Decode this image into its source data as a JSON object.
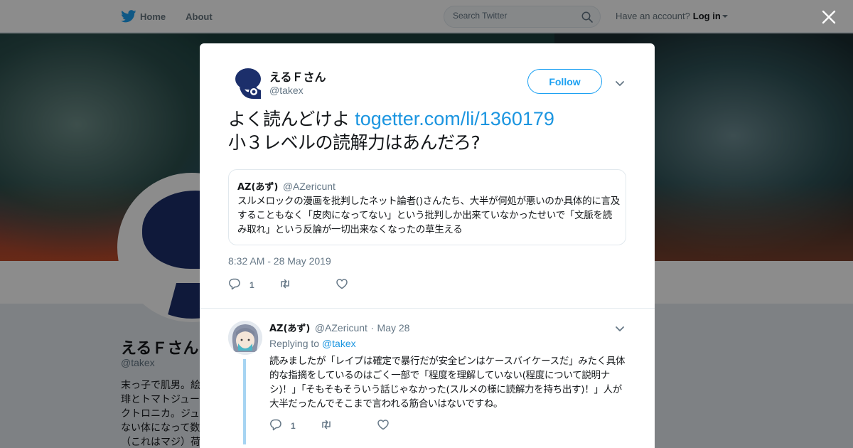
{
  "nav": {
    "home_label": "Home",
    "about_label": "About",
    "search_placeholder": "Search Twitter",
    "account_prompt": "Have an account?",
    "login_label": "Log in",
    "brand_color": "#1da1f2"
  },
  "profile": {
    "name": "えるＦさん",
    "handle": "@takex",
    "bio_lines": [
      "末っ子で肌男。絵",
      "琲とトマトジュー",
      "クトロニカ。ジュ",
      "ない体になって数",
      "（これはマジ）荷"
    ]
  },
  "tweet": {
    "author_name": "えるＦさん",
    "author_handle": "@takex",
    "follow_label": "Follow",
    "text_before_link": "よく読んどけよ ",
    "link_text": "togetter.com/li/1360179",
    "text_after_link": "小３レベルの読解力はあんだろ?",
    "quote": {
      "name": "AZ(あず)",
      "handle": "@AZericunt",
      "text": "スルメロックの漫画を批判したネット論者()さんたち、大半が何処が悪いのか具体的に言及することもなく「皮肉になってない」という批判しか出来ていなかったせいで「文脈を読み取れ」という反論が一切出来なくなったの草生える"
    },
    "timestamp": "8:32 AM - 28 May 2019",
    "reply_count": "1",
    "link_color": "#1b95e0"
  },
  "reply": {
    "name": "AZ(あず)",
    "handle": "@AZericunt",
    "separator": "·",
    "date": "May 28",
    "replying_prefix": "Replying to",
    "replying_to": "@takex",
    "text": "読みましたが「レイプは確定で暴行だが安全ピンはケースバイケースだ」みたく具体的な指摘をしているのはごく一部で「程度を理解していない(程度について説明ナシ)！」「そもそもそういう話じゃなかった(スルメの様に読解力を持ち出す)！」人が大半だったんでそこまで言われる筋合いはないですね。",
    "reply_count": "1"
  },
  "icons": [
    "twitter-bird-icon",
    "search-icon",
    "close-icon",
    "chevron-down-icon",
    "reply-icon",
    "retweet-icon",
    "like-icon"
  ]
}
